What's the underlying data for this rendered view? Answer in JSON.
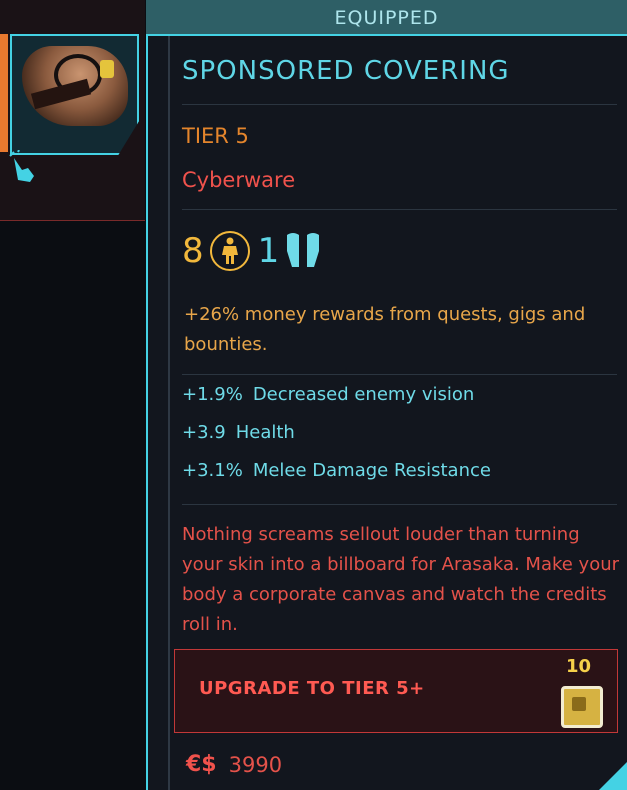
{
  "status_bar": {
    "label": "EQUIPPED"
  },
  "item": {
    "name": "SPONSORED COVERING",
    "tier": "TIER 5",
    "category": "Cyberware",
    "capacity_cost": "8",
    "slot_count": "1",
    "effect": "+26% money rewards from quests, gigs and bounties.",
    "bonuses": [
      {
        "value": "+1.9%",
        "label": "Decreased enemy vision"
      },
      {
        "value": "+3.9",
        "label": "Health"
      },
      {
        "value": "+3.1%",
        "label": "Melee Damage Resistance"
      }
    ],
    "description": "Nothing screams sellout louder than turning your skin into a billboard for Arasaka. Make your body a corporate canvas and watch the credits roll in."
  },
  "upgrade": {
    "label": "UPGRADE TO TIER 5+",
    "cost": "10"
  },
  "price": {
    "currency_symbol": "€$",
    "value": "3990"
  },
  "colors": {
    "accent_cyan": "#44d2e4",
    "tier_orange": "#e4852c",
    "warning_red": "#f0524c",
    "gold": "#f2b83c"
  },
  "icons": [
    "hand-cursor-icon",
    "body-capacity-icon",
    "arms-slot-icon",
    "upgrade-component-icon"
  ]
}
